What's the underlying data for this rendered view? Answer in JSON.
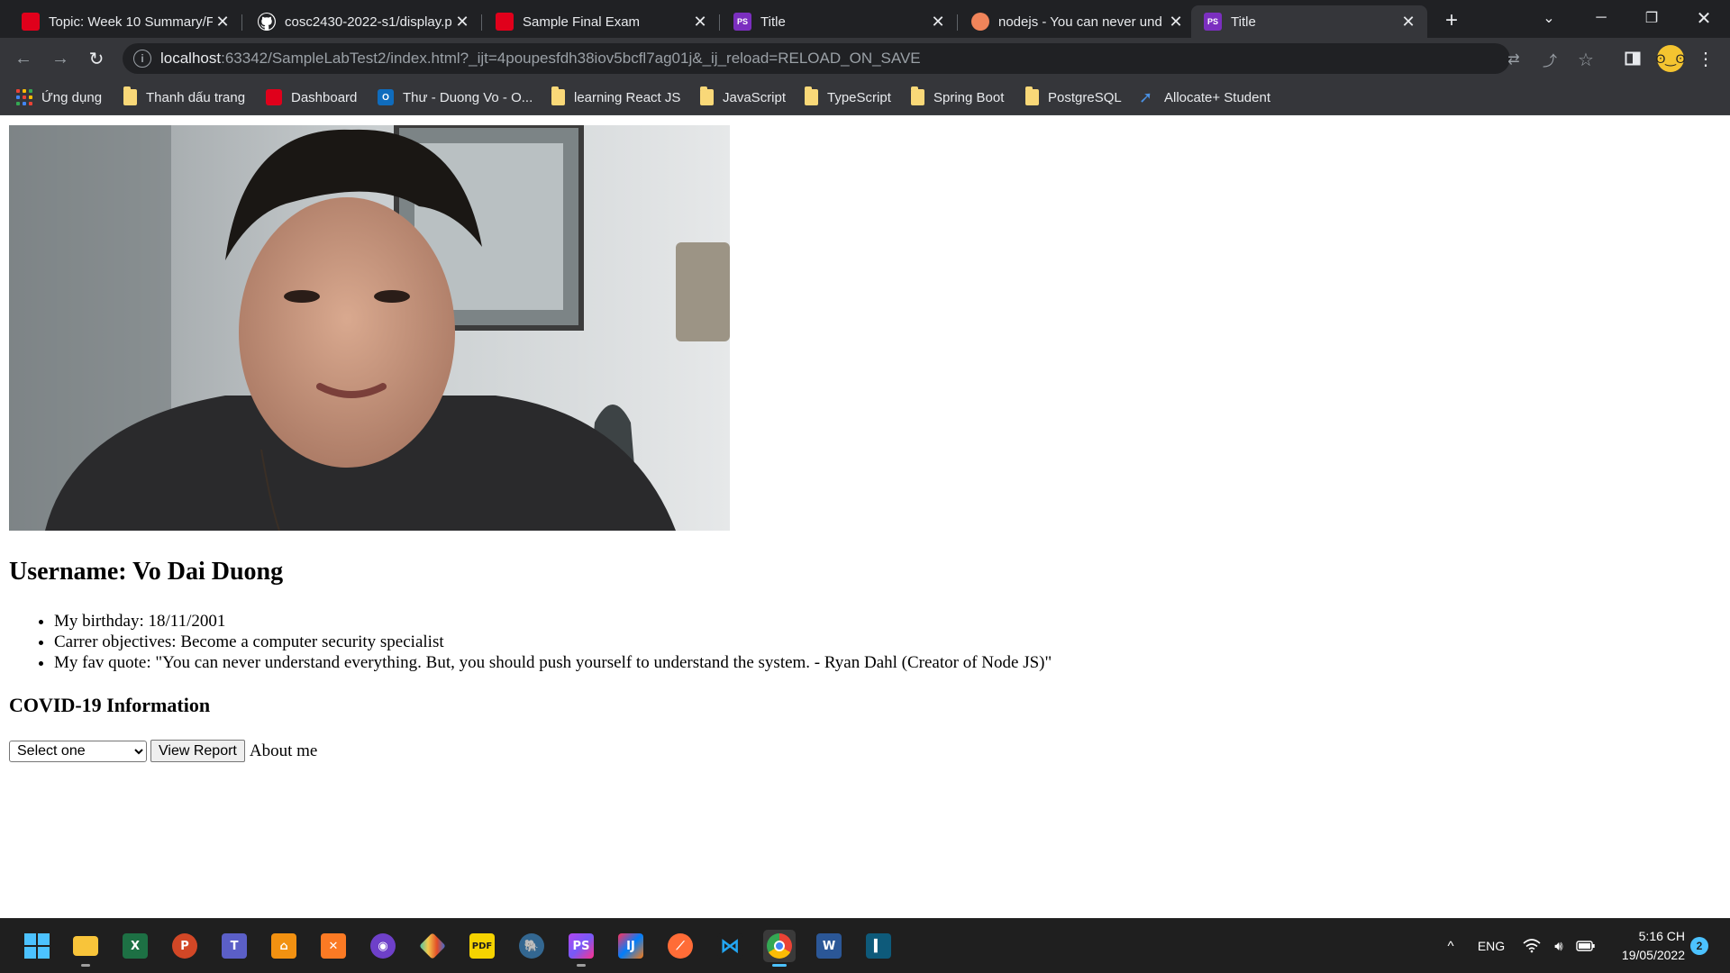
{
  "browser": {
    "tabs": [
      {
        "title": "Topic: Week 10 Summary/F",
        "icon": "red-app-icon",
        "active": false
      },
      {
        "title": "cosc2430-2022-s1/display.p",
        "icon": "github-icon",
        "active": false
      },
      {
        "title": "Sample Final Exam",
        "icon": "red-app-icon",
        "active": false
      },
      {
        "title": "Title",
        "icon": "phpstorm-icon",
        "active": false
      },
      {
        "title": "nodejs - You can never und",
        "icon": "nodejs-icon",
        "active": false
      },
      {
        "title": "Title",
        "icon": "phpstorm-icon",
        "active": true
      }
    ],
    "address": {
      "host": "localhost",
      "rest": ":63342/SampleLabTest2/index.html?_ijt=4poupesfdh38iov5bcfl7ag01j&_ij_reload=RELOAD_ON_SAVE"
    },
    "bookmarks": [
      {
        "label": "Ứng dụng",
        "icon": "apps-grid-icon"
      },
      {
        "label": "Thanh dấu trang",
        "icon": "folder-icon"
      },
      {
        "label": "Dashboard",
        "icon": "red-app-icon"
      },
      {
        "label": "Thư - Duong Vo - O...",
        "icon": "outlook-icon"
      },
      {
        "label": "learning React JS",
        "icon": "folder-icon"
      },
      {
        "label": "JavaScript",
        "icon": "folder-icon"
      },
      {
        "label": "TypeScript",
        "icon": "folder-icon"
      },
      {
        "label": "Spring Boot",
        "icon": "folder-icon"
      },
      {
        "label": "PostgreSQL",
        "icon": "folder-icon"
      },
      {
        "label": "Allocate+ Student",
        "icon": "allocate-icon"
      }
    ]
  },
  "page": {
    "username": "Username: Vo Dai Duong",
    "about_items": [
      "My birthday: 18/11/2001",
      "Carrer objectives: Become a computer security specialist",
      "My fav quote: \"You can never understand everything. But, you should push yourself to understand the system. - Ryan Dahl (Creator of Node JS)\""
    ],
    "covid_title": "COVID-19 Information",
    "select_value": "Select one",
    "view_report_label": "View Report",
    "about_me_link": "About me"
  },
  "taskbar": {
    "apps": [
      "start-icon",
      "file-explorer-icon",
      "excel-icon",
      "powerpoint-icon",
      "teams-icon",
      "xampp-icon",
      "xampp-control-icon",
      "github-desktop-icon",
      "gitkraken-icon",
      "pdf-icon",
      "postgresql-icon",
      "phpstorm-icon",
      "intellij-icon",
      "postman-icon",
      "vscode-icon",
      "chrome-icon",
      "word-icon",
      "app-icon"
    ],
    "language": "ENG",
    "time": "5:16 CH",
    "date": "19/05/2022",
    "notifications": "2"
  },
  "colors": {
    "tab_bg": "#202124",
    "toolbar_bg": "#35363a",
    "taskbar_bg": "#1f1f1f",
    "accent": "#4cc2ff"
  }
}
